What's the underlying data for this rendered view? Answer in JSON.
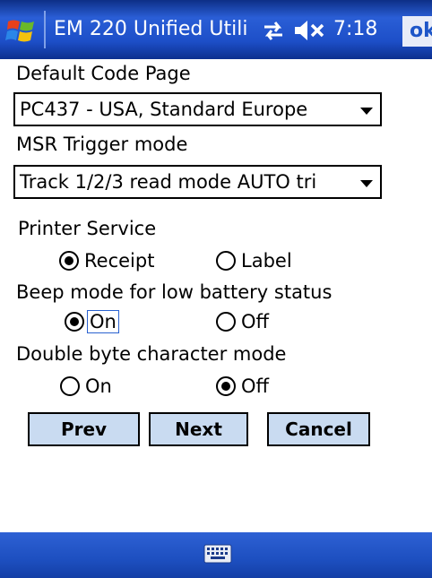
{
  "titlebar": {
    "title": "EM 220 Unified Utili",
    "time": "7:18",
    "ok_label": "ok",
    "icons": [
      "windows-start-icon",
      "connectivity-icon",
      "speaker-muted-icon"
    ]
  },
  "form": {
    "code_page": {
      "label": "Default Code Page",
      "value": "PC437 - USA, Standard Europe"
    },
    "msr": {
      "label": "MSR Trigger mode",
      "value": "Track 1/2/3 read mode AUTO tri"
    },
    "printer_service": {
      "label": "Printer Service",
      "options": [
        "Receipt",
        "Label"
      ],
      "selected": "Receipt"
    },
    "beep_mode": {
      "label": "Beep mode for low battery status",
      "options": [
        "On",
        "Off"
      ],
      "selected": "On"
    },
    "double_byte": {
      "label": "Double byte character mode",
      "options": [
        "On",
        "Off"
      ],
      "selected": "Off"
    }
  },
  "buttons": {
    "prev": "Prev",
    "next": "Next",
    "cancel": "Cancel"
  },
  "bottombar": {
    "icon": "keyboard-icon"
  },
  "colors": {
    "titlebar": "#1d4fc8",
    "button_face": "#c9dbf1",
    "ok_text": "#1e56c8"
  }
}
